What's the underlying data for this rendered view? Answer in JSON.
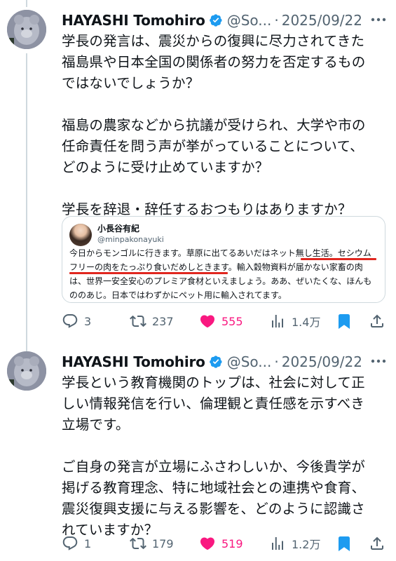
{
  "tweets": [
    {
      "author_name": "HAYASHI Tomohiro",
      "handle": "@So...",
      "separator": "·",
      "date": "2025/09/22",
      "text": "学長の発言は、震災からの復興に尽力されてきた\n福島県や日本全国の関係者の努力を否定するもの\nではないでしょうか？\n\n福島の農家などから抗議が受けられ、大学や市の\n任命責任を問う声が挙がっていることについて、\nどのように受け止めていますか？\n\n学長を辞退・辞任するおつもりはありますか？",
      "quote": {
        "author_name": "小長谷有紀",
        "handle": "@minpakonayuki",
        "text": "今日からモンゴルに行きます。草原に出てるあいだはネット無し生活。セシウム\nフリーの肉をたっぷり食いだめしときます。輸入穀物資料が届かない家畜の肉\nは、世界一安全安心のプレミア食材といえましょう。ああ、ぜいたくな、ほんも\nののあじ。日本ではわずかにペット用に輸入されてます。"
      },
      "stats": {
        "replies": "3",
        "reposts": "237",
        "likes": "555",
        "views": "1.4万"
      }
    },
    {
      "author_name": "HAYASHI Tomohiro",
      "handle": "@So...",
      "separator": "·",
      "date": "2025/09/22",
      "text": "学長という教育機関のトップは、社会に対して正\nしい情報発信を行い、倫理観と責任感を示すべき\n立場です。\n\nご自身の発言が立場にふさわしいか、今後貴学が\n掲げる教育理念、特に地域社会との連携や食育、\n震災復興支援に与える影響を、どのように認識さ\nれていますか？",
      "stats": {
        "replies": "1",
        "reposts": "179",
        "likes": "519",
        "views": "1.2万"
      }
    }
  ],
  "colors": {
    "text": "#0f1419",
    "secondary": "#536471",
    "verified": "#1d9bf0",
    "like": "#f91880",
    "bookmark": "#1d9bf0",
    "underline": "#e0271f",
    "thread_line": "#cfd9de"
  },
  "icons": {
    "verified": "verified-badge-icon",
    "more": "more-icon",
    "reply": "reply-icon",
    "repost": "repost-icon",
    "like": "heart-icon",
    "views": "views-icon",
    "bookmark": "bookmark-icon",
    "share": "share-icon"
  }
}
